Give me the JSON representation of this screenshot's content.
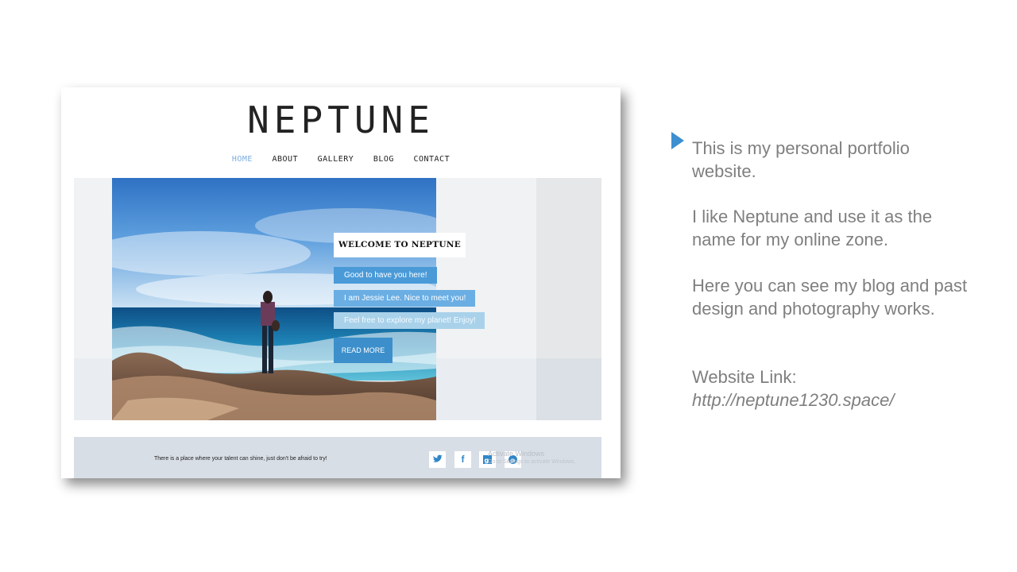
{
  "website": {
    "logo": "NEPTUNE",
    "nav": [
      "HOME",
      "ABOUT",
      "GALLERY",
      "BLOG",
      "CONTACT"
    ],
    "active_nav": "HOME",
    "hero": {
      "welcome": "WELCOME TO NEPTUNE",
      "messages": [
        "Good to have you here!",
        "I am Jessie Lee. Nice to meet you!",
        "Feel free to explore my planet! Enjoy!"
      ],
      "read_more": "READ MORE"
    },
    "footer": {
      "tagline": "There is a place where your talent can shine, just don't be afraid to try!",
      "social_icons": [
        "twitter-icon",
        "facebook-icon",
        "google-plus-icon",
        "pinterest-icon"
      ]
    },
    "watermark": {
      "title": "Activate Windows",
      "subtitle": "Go to Settings to activate Windows."
    }
  },
  "description": {
    "p1": "This is my personal portfolio website.",
    "p2": "I like Neptune and use it as the name for my online zone.",
    "p3": "Here you can see my blog and past design and photography works.",
    "p4_label": "Website Link:",
    "p4_link": "http://neptune1230.space/"
  },
  "colors": {
    "accent": "#3c8fd0",
    "body_text": "#7f7f7f",
    "nav_active": "#7aaee0"
  }
}
